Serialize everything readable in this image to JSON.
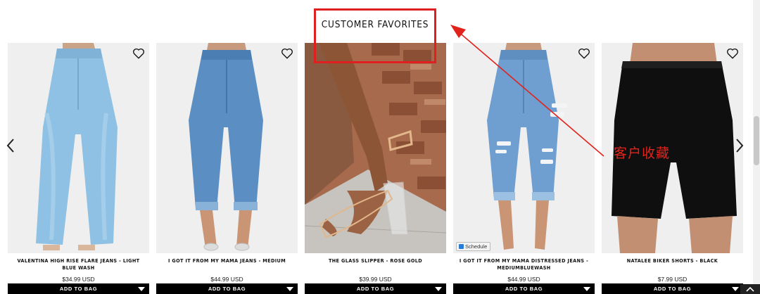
{
  "section": {
    "title": "CUSTOMER FAVORITES"
  },
  "annotation": {
    "text": "客户收藏",
    "color": "#e0241c"
  },
  "products": [
    {
      "name": "VALENTINA HIGH RISE FLARE JEANS - LIGHT BLUE WASH",
      "price": "$34.99 USD",
      "cta": "ADD TO BAG"
    },
    {
      "name": "I GOT IT FROM MY MAMA JEANS - MEDIUM",
      "price": "$44.99 USD",
      "cta": "ADD TO BAG"
    },
    {
      "name": "THE GLASS SLIPPER - ROSE GOLD",
      "price": "$39.99 USD",
      "cta": "ADD TO BAG"
    },
    {
      "name": "I GOT IT FROM MY MAMA DISTRESSED JEANS - MEDIUMBLUEWASH",
      "price": "$44.99 USD",
      "cta": "ADD TO BAG",
      "badge": "Schedule"
    },
    {
      "name": "NATALEE BIKER SHORTS - BLACK",
      "price": "$7.99 USD",
      "cta": "ADD TO BAG"
    }
  ],
  "icons": {
    "wishlist": "heart-outline-icon",
    "prev": "chevron-left-icon",
    "next": "chevron-right-icon"
  }
}
